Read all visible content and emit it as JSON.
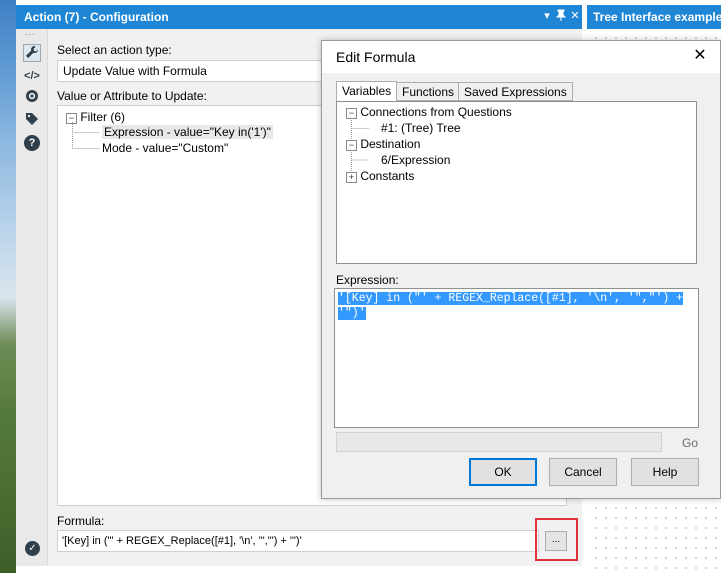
{
  "config_panel": {
    "title": "Action (7) - Configuration",
    "dropdown_icon": "▾",
    "pin_icon": "📌",
    "close_icon": "✕",
    "action_type_label": "Select an action type:",
    "action_type_value": "Update Value with Formula",
    "value_label": "Value or Attribute to Update:",
    "tree": {
      "root_label": "Filter (6)",
      "root_expander": "−",
      "children": [
        "Expression - value=\"Key in('1')\"",
        "Mode - value=\"Custom\""
      ]
    },
    "formula_label": "Formula:",
    "formula_value": "'[Key] in (\"' + REGEX_Replace([#1], '\\n', '\",\"') + '\")'",
    "ellipsis_label": "..."
  },
  "toolstrip": {
    "grip": "···",
    "items": [
      {
        "name": "wrench-icon",
        "glyph": "🔧"
      },
      {
        "name": "code-icon",
        "glyph": "</>"
      },
      {
        "name": "target-icon",
        "glyph": "◎"
      },
      {
        "name": "tag-icon",
        "glyph": "🏷"
      },
      {
        "name": "help-icon",
        "glyph": "?"
      }
    ],
    "status_glyph": "✓"
  },
  "tree_interface_panel": {
    "title": "Tree Interface example P"
  },
  "edit_formula_dialog": {
    "title": "Edit Formula",
    "close": "✕",
    "tabs": [
      "Variables",
      "Functions",
      "Saved Expressions"
    ],
    "active_tab": "Variables",
    "variables": [
      {
        "label": "Connections from Questions",
        "expander": "−",
        "level": 0
      },
      {
        "label": "#1: (Tree) Tree",
        "expander": "",
        "level": 1
      },
      {
        "label": "Destination",
        "expander": "−",
        "level": 0
      },
      {
        "label": "6/Expression",
        "expander": "",
        "level": 1
      },
      {
        "label": "Constants",
        "expander": "+",
        "level": 0
      }
    ],
    "expression_label": "Expression:",
    "expression_line1": "'[Key] in (\"' + REGEX_Replace([#1], '\\n', '\",\"') +",
    "expression_line2": "'\")'",
    "go_label": "Go",
    "ok_label": "OK",
    "cancel_label": "Cancel",
    "help_label": "Help"
  },
  "colors": {
    "header_blue": "#1f86d6",
    "selection_blue": "#3399ff",
    "highlight_red": "#e0303a"
  }
}
